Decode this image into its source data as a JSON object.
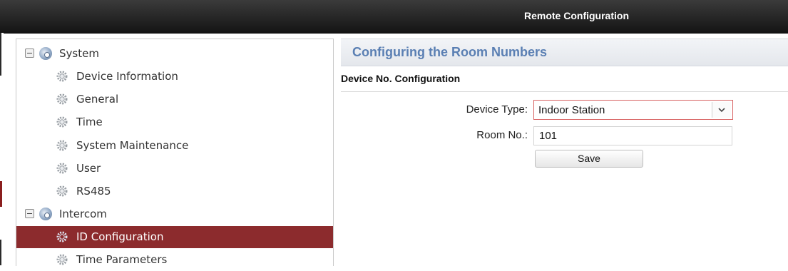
{
  "window": {
    "title": "Remote Configuration"
  },
  "sidebar": {
    "groups": [
      {
        "label": "System",
        "expanded": true,
        "items": [
          {
            "label": "Device Information"
          },
          {
            "label": "General"
          },
          {
            "label": "Time"
          },
          {
            "label": "System Maintenance"
          },
          {
            "label": "User"
          },
          {
            "label": "RS485"
          }
        ]
      },
      {
        "label": "Intercom",
        "expanded": true,
        "items": [
          {
            "label": "ID Configuration",
            "selected": true
          },
          {
            "label": "Time Parameters"
          }
        ]
      }
    ]
  },
  "main": {
    "heading": "Configuring the Room Numbers",
    "section_title": "Device No. Configuration",
    "form": {
      "device_type_label": "Device Type:",
      "device_type_value": "Indoor Station",
      "room_no_label": "Room No.:",
      "room_no_value": "101",
      "save_label": "Save"
    }
  },
  "colors": {
    "selected_bg": "#8c2b2d",
    "heading_text": "#5a7fb3",
    "select_border": "#d86464",
    "titlebar": "#1f1f1f"
  }
}
